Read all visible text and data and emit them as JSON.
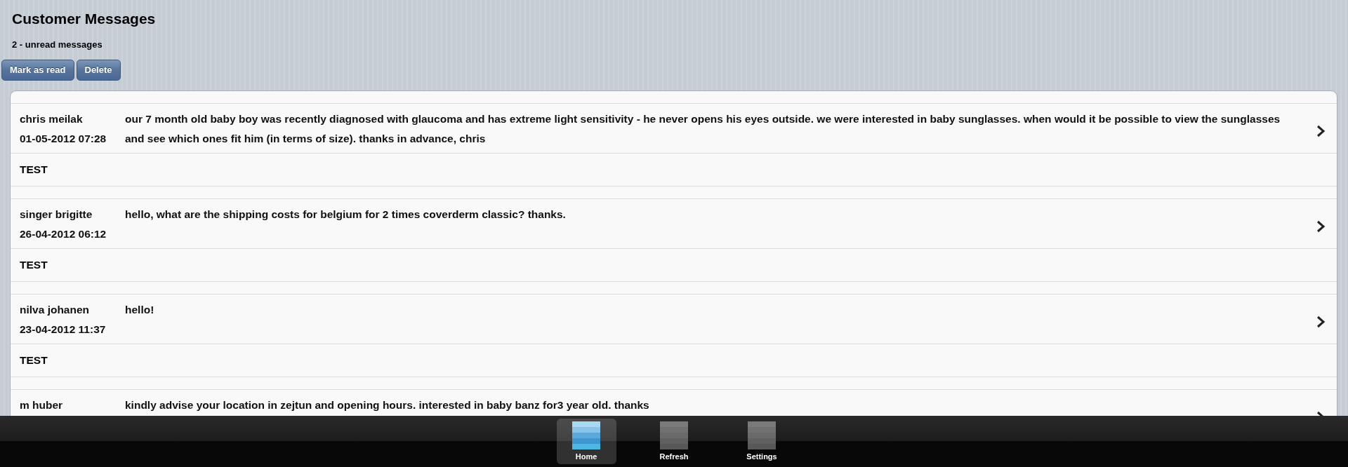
{
  "title": "Customer Messages",
  "unread_summary": "2 - unread messages",
  "toolbar_buttons": [
    "Mark as read",
    "Delete"
  ],
  "messages": [
    {
      "name": "chris meilak",
      "date": "01-05-2012 07:28",
      "text": "our 7 month old baby boy was recently diagnosed with glaucoma and has extreme light sensitivity - he never opens his eyes outside. we were interested in baby sunglasses. when would it be possible to view the sunglasses and see which ones fit him (in terms of size). thanks in advance, chris",
      "note": "TEST"
    },
    {
      "name": "singer brigitte",
      "date": "26-04-2012 06:12",
      "text": "hello, what are the shipping costs for belgium for 2 times coverderm classic? thanks.",
      "note": "TEST"
    },
    {
      "name": "nilva johanen",
      "date": "23-04-2012 11:37",
      "text": "hello!",
      "note": "TEST"
    },
    {
      "name": "m huber",
      "text": "kindly advise your location in zejtun and opening hours. interested in baby banz for3 year old. thanks"
    }
  ],
  "tab_bar": [
    {
      "label": "Home",
      "selected": true
    },
    {
      "label": "Refresh",
      "selected": false
    },
    {
      "label": "Settings",
      "selected": false
    }
  ]
}
